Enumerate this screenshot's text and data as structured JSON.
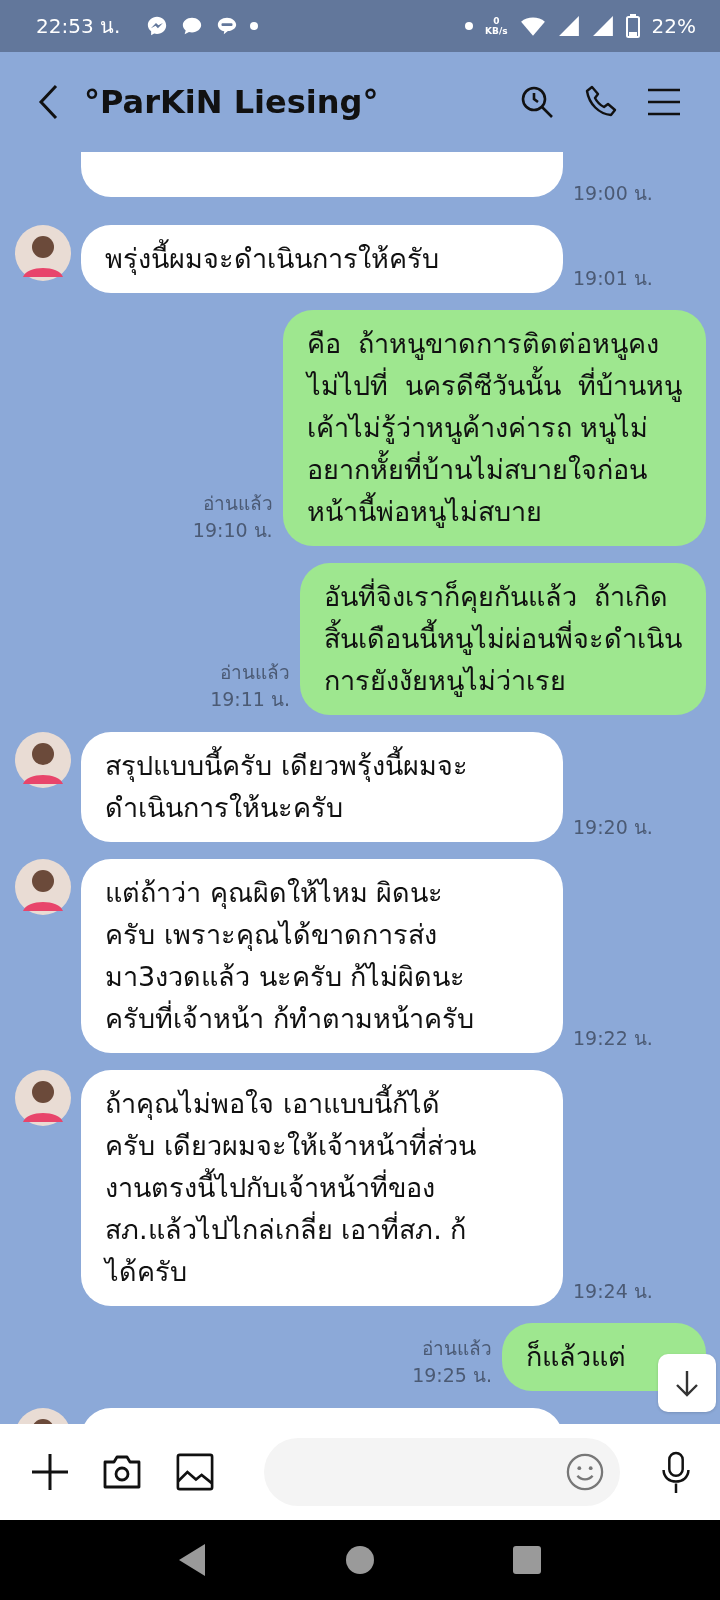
{
  "status_bar": {
    "time": "22:53 น.",
    "net_speed_value": "0",
    "net_speed_unit": "KB/s",
    "battery": "22%"
  },
  "header": {
    "title": "°ParKiN Liesing°"
  },
  "messages": [
    {
      "kind": "received_cut_top",
      "time": "19:00 น."
    },
    {
      "kind": "received",
      "text": "พรุ่งนี้ผมจะดำเนินการให้ครับ",
      "time": "19:01 น."
    },
    {
      "kind": "sent",
      "text": "คือ  ถ้าหนูขาดการติดต่อหนูคง\nไม่ไปที่  นครดีซีวันนั้น  ที่บ้านหนู\nเค้าไม่รู้ว่าหนูค้างค่ารถ หนูไม่\nอยากหั้ยที่บ้านไม่สบายใจก่อน\nหน้านี้พ่อหนูไม่สบาย",
      "read_receipt": "อ่านแล้ว",
      "time": "19:10 น."
    },
    {
      "kind": "sent",
      "text": "อันที่จิงเราก็คุยกันแล้ว  ถ้าเกิด\nสิ้นเดือนนี้หนูไม่ผ่อนพี่จะดำเนิน\nการยังงัยหนูไม่ว่าเรย",
      "read_receipt": "อ่านแล้ว",
      "time": "19:11 น."
    },
    {
      "kind": "received",
      "text": "สรุปแบบนี้ครับ เดียวพรุ้งนี้ผมจะ\nดำเนินการให้นะครับ",
      "time": "19:20 น."
    },
    {
      "kind": "received",
      "text": "แต่ถ้าว่า คุณผิดให้ไหม ผิดนะ\nครับ เพราะคุณได้ขาดการส่ง\nมา3งวดแล้ว นะครับ ก้ไม่ผิดนะ\nครับที่เจ้าหน้า ก้ทำตามหน้าครับ",
      "time": "19:22 น."
    },
    {
      "kind": "received",
      "text": "ถ้าคุณไม่พอใจ เอาแบบนี้ก้ได้\nครับ เดียวผมจะให้เจ้าหน้าที่ส่วน\nงานตรงนี้ไปกับเจ้าหน้าที่ของ\nสภ.แล้วไปไกล่เกลี่ย เอาที่สภ. ก้\nได้ครับ",
      "time": "19:24 น."
    },
    {
      "kind": "sent_covered",
      "text": "ก็แล้วแต่",
      "read_receipt": "อ่านแล้ว",
      "time": "19:25 น."
    },
    {
      "kind": "received_cut_bottom"
    }
  ]
}
